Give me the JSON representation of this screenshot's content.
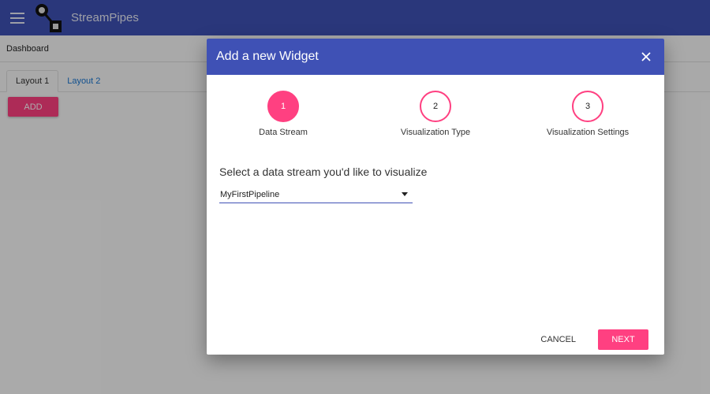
{
  "app": {
    "title": "StreamPipes"
  },
  "page": {
    "breadcrumb": "Dashboard",
    "tabs": [
      {
        "label": "Layout 1"
      },
      {
        "label": "Layout 2"
      }
    ],
    "add_label": "ADD"
  },
  "dialog": {
    "title": "Add a new Widget",
    "steps": [
      {
        "number": "1",
        "label": "Data Stream"
      },
      {
        "number": "2",
        "label": "Visualization Type"
      },
      {
        "number": "3",
        "label": "Visualization Settings"
      }
    ],
    "question": "Select a data stream you'd like to visualize",
    "selected_stream": "MyFirstPipeline",
    "cancel_label": "CANCEL",
    "next_label": "NEXT"
  },
  "colors": {
    "primary": "#3f51b5",
    "accent": "#ff4081"
  }
}
